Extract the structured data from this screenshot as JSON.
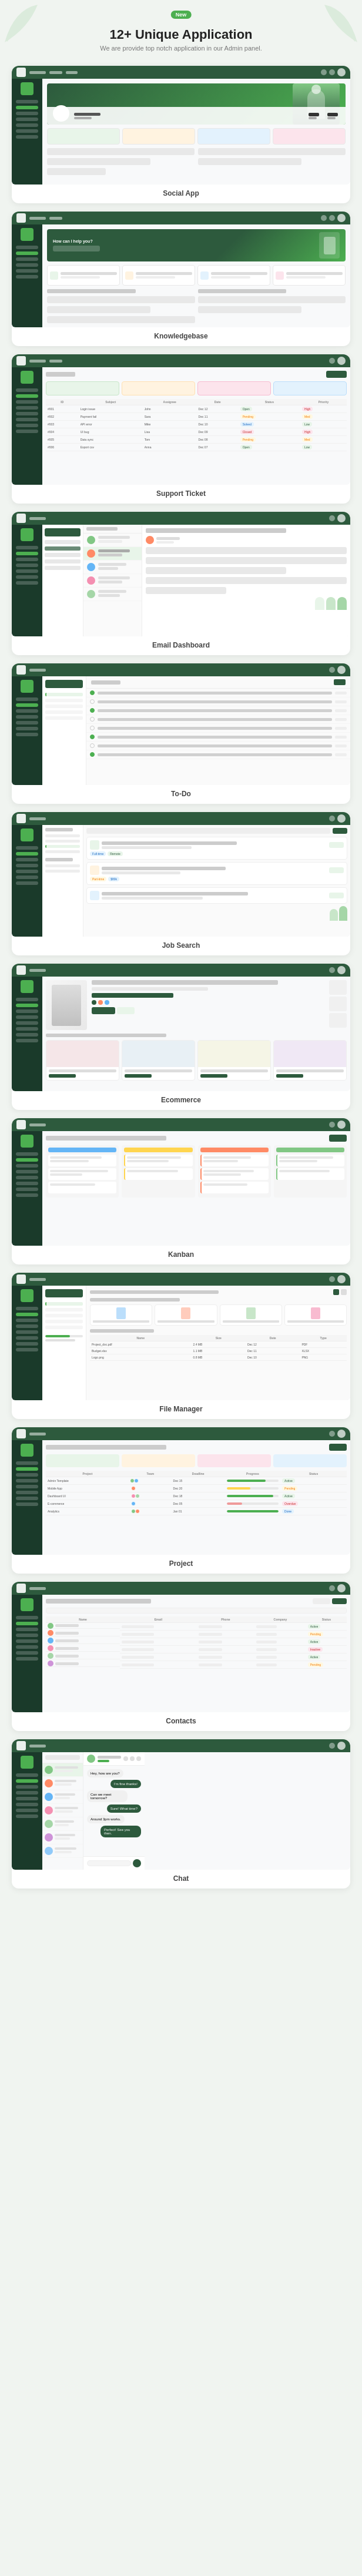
{
  "header": {
    "badge": "New",
    "title": "12+ Unique Application",
    "subtitle": "We are provide top notch application in our Admin panel."
  },
  "apps": [
    {
      "id": "social",
      "label": "Social App",
      "type": "social"
    },
    {
      "id": "knowledgebase",
      "label": "Knowledgebase",
      "type": "knowledgebase"
    },
    {
      "id": "support-ticket",
      "label": "Support Ticket",
      "type": "support"
    },
    {
      "id": "email",
      "label": "Email Dashboard",
      "type": "email"
    },
    {
      "id": "todo",
      "label": "To-Do",
      "type": "todo"
    },
    {
      "id": "job-search",
      "label": "Job Search",
      "type": "job"
    },
    {
      "id": "ecommerce",
      "label": "Ecommerce",
      "type": "ecommerce"
    },
    {
      "id": "kanban",
      "label": "Kanban",
      "type": "kanban"
    },
    {
      "id": "file-manager",
      "label": "File Manager",
      "type": "filemanager"
    },
    {
      "id": "project",
      "label": "Project",
      "type": "project"
    },
    {
      "id": "contacts",
      "label": "Contacts",
      "type": "contacts"
    },
    {
      "id": "chat",
      "label": "Chat",
      "type": "chat"
    }
  ],
  "colors": {
    "primary": "#2d5a3d",
    "accent": "#4CAF50",
    "bg": "#f0f4f0"
  }
}
